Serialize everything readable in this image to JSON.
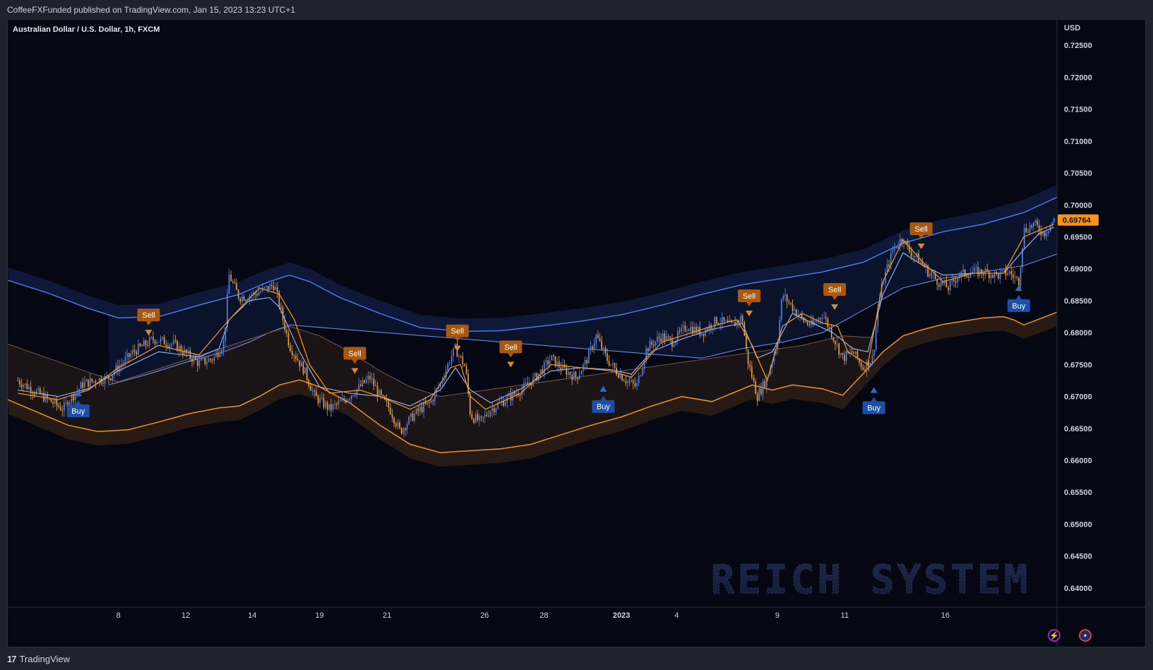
{
  "header": {
    "publisher": "CoffeeFXFunded published on TradingView.com, Jan 15, 2023 13:23 UTC+1"
  },
  "footer": {
    "brand": "TradingView"
  },
  "icons": {
    "logo": "tradingview-logo-icon",
    "lightning": "lightning-icon",
    "flag": "australia-flag-icon"
  },
  "colors": {
    "background": "#050813",
    "up_candle": "#5b86e5",
    "down_candle": "#f2a33a",
    "blue_line": "#4f7df5",
    "orange_line": "#f0921e",
    "buy_label": "#1d4fa8",
    "sell_label": "#a8590f",
    "price_tag": "#f7931a",
    "watermark": "#1b2542"
  },
  "chart_data": {
    "type": "candlestick",
    "title": "Australian Dollar / U.S. Dollar, 1h, FXCM",
    "currency": "USD",
    "watermark": "REICH SYSTEM",
    "last_price": 0.69764,
    "last_price_label": "0.69764",
    "ylim": [
      0.637,
      0.729
    ],
    "yticks": [
      {
        "value": 0.725,
        "label": "0.72500"
      },
      {
        "value": 0.72,
        "label": "0.72000"
      },
      {
        "value": 0.715,
        "label": "0.71500"
      },
      {
        "value": 0.71,
        "label": "0.71000"
      },
      {
        "value": 0.705,
        "label": "0.70500"
      },
      {
        "value": 0.7,
        "label": "0.70000"
      },
      {
        "value": 0.695,
        "label": "0.69500"
      },
      {
        "value": 0.69,
        "label": "0.69000"
      },
      {
        "value": 0.685,
        "label": "0.68500"
      },
      {
        "value": 0.68,
        "label": "0.68000"
      },
      {
        "value": 0.675,
        "label": "0.67500"
      },
      {
        "value": 0.67,
        "label": "0.67000"
      },
      {
        "value": 0.665,
        "label": "0.66500"
      },
      {
        "value": 0.66,
        "label": "0.66000"
      },
      {
        "value": 0.655,
        "label": "0.65500"
      },
      {
        "value": 0.65,
        "label": "0.65000"
      },
      {
        "value": 0.645,
        "label": "0.64500"
      },
      {
        "value": 0.64,
        "label": "0.64000"
      }
    ],
    "xlim": [
      5.9,
      16.33
    ],
    "xticks": [
      {
        "t": 7.0,
        "label": "8"
      },
      {
        "t": 7.67,
        "label": "12"
      },
      {
        "t": 8.33,
        "label": "14"
      },
      {
        "t": 9.0,
        "label": "19"
      },
      {
        "t": 9.67,
        "label": "21"
      },
      {
        "t": 10.64,
        "label": "26"
      },
      {
        "t": 11.23,
        "label": "28"
      },
      {
        "t": 12.0,
        "label": "2023",
        "bold": true
      },
      {
        "t": 12.55,
        "label": "4"
      },
      {
        "t": 13.55,
        "label": "9"
      },
      {
        "t": 14.22,
        "label": "11"
      },
      {
        "t": 15.22,
        "label": "16"
      }
    ],
    "price_path": [
      [
        6.0,
        0.6725
      ],
      [
        6.2,
        0.6705
      ],
      [
        6.45,
        0.668
      ],
      [
        6.5,
        0.6692
      ],
      [
        6.65,
        0.672
      ],
      [
        6.9,
        0.673
      ],
      [
        7.15,
        0.677
      ],
      [
        7.35,
        0.679
      ],
      [
        7.55,
        0.6782
      ],
      [
        7.65,
        0.677
      ],
      [
        7.8,
        0.6752
      ],
      [
        7.95,
        0.676
      ],
      [
        8.05,
        0.6785
      ],
      [
        8.1,
        0.689
      ],
      [
        8.2,
        0.6855
      ],
      [
        8.35,
        0.686
      ],
      [
        8.55,
        0.6875
      ],
      [
        8.7,
        0.678
      ],
      [
        8.85,
        0.674
      ],
      [
        8.95,
        0.67
      ],
      [
        9.1,
        0.668
      ],
      [
        9.25,
        0.6695
      ],
      [
        9.4,
        0.6715
      ],
      [
        9.5,
        0.673
      ],
      [
        9.6,
        0.67
      ],
      [
        9.7,
        0.668
      ],
      [
        9.8,
        0.6645
      ],
      [
        9.9,
        0.6665
      ],
      [
        10.0,
        0.668
      ],
      [
        10.1,
        0.669
      ],
      [
        10.2,
        0.672
      ],
      [
        10.3,
        0.676
      ],
      [
        10.35,
        0.6775
      ],
      [
        10.45,
        0.6745
      ],
      [
        10.5,
        0.667
      ],
      [
        10.6,
        0.666
      ],
      [
        10.7,
        0.668
      ],
      [
        10.85,
        0.6695
      ],
      [
        11.0,
        0.671
      ],
      [
        11.15,
        0.673
      ],
      [
        11.3,
        0.676
      ],
      [
        11.4,
        0.6745
      ],
      [
        11.55,
        0.673
      ],
      [
        11.65,
        0.6755
      ],
      [
        11.75,
        0.6795
      ],
      [
        11.85,
        0.676
      ],
      [
        11.95,
        0.674
      ],
      [
        12.05,
        0.6725
      ],
      [
        12.15,
        0.6715
      ],
      [
        12.25,
        0.6775
      ],
      [
        12.4,
        0.6795
      ],
      [
        12.5,
        0.6785
      ],
      [
        12.65,
        0.681
      ],
      [
        12.8,
        0.68
      ],
      [
        12.95,
        0.682
      ],
      [
        13.1,
        0.681
      ],
      [
        13.2,
        0.6825
      ],
      [
        13.25,
        0.676
      ],
      [
        13.35,
        0.67
      ],
      [
        13.45,
        0.673
      ],
      [
        13.55,
        0.6785
      ],
      [
        13.6,
        0.686
      ],
      [
        13.7,
        0.684
      ],
      [
        13.8,
        0.682
      ],
      [
        13.9,
        0.681
      ],
      [
        14.0,
        0.683
      ],
      [
        14.1,
        0.6795
      ],
      [
        14.2,
        0.676
      ],
      [
        14.3,
        0.677
      ],
      [
        14.4,
        0.6745
      ],
      [
        14.5,
        0.676
      ],
      [
        14.55,
        0.684
      ],
      [
        14.6,
        0.688
      ],
      [
        14.7,
        0.693
      ],
      [
        14.8,
        0.695
      ],
      [
        14.85,
        0.693
      ],
      [
        14.95,
        0.6915
      ],
      [
        15.05,
        0.6895
      ],
      [
        15.15,
        0.688
      ],
      [
        15.25,
        0.687
      ],
      [
        15.35,
        0.689
      ],
      [
        15.5,
        0.6895
      ],
      [
        15.6,
        0.6895
      ],
      [
        15.75,
        0.689
      ],
      [
        15.85,
        0.6895
      ],
      [
        15.95,
        0.688
      ],
      [
        16.0,
        0.696
      ],
      [
        16.1,
        0.697
      ],
      [
        16.2,
        0.6955
      ],
      [
        16.3,
        0.6976
      ]
    ],
    "blue_fast_path": [
      [
        6.0,
        0.671
      ],
      [
        6.4,
        0.67
      ],
      [
        6.7,
        0.6712
      ],
      [
        7.0,
        0.674
      ],
      [
        7.4,
        0.677
      ],
      [
        7.8,
        0.6762
      ],
      [
        8.0,
        0.6775
      ],
      [
        8.1,
        0.682
      ],
      [
        8.3,
        0.685
      ],
      [
        8.5,
        0.6855
      ],
      [
        8.6,
        0.684
      ],
      [
        8.8,
        0.677
      ],
      [
        9.0,
        0.6715
      ],
      [
        9.3,
        0.6705
      ],
      [
        9.6,
        0.67
      ],
      [
        9.9,
        0.6685
      ],
      [
        10.2,
        0.671
      ],
      [
        10.35,
        0.6745
      ],
      [
        10.5,
        0.671
      ],
      [
        10.7,
        0.669
      ],
      [
        11.0,
        0.6712
      ],
      [
        11.3,
        0.674
      ],
      [
        11.6,
        0.6745
      ],
      [
        11.9,
        0.6742
      ],
      [
        12.1,
        0.6735
      ],
      [
        12.3,
        0.677
      ],
      [
        12.6,
        0.679
      ],
      [
        12.9,
        0.6805
      ],
      [
        13.2,
        0.6815
      ],
      [
        13.35,
        0.676
      ],
      [
        13.5,
        0.677
      ],
      [
        13.7,
        0.683
      ],
      [
        13.9,
        0.6815
      ],
      [
        14.1,
        0.68
      ],
      [
        14.3,
        0.6775
      ],
      [
        14.45,
        0.677
      ],
      [
        14.6,
        0.686
      ],
      [
        14.8,
        0.6925
      ],
      [
        15.0,
        0.6905
      ],
      [
        15.2,
        0.689
      ],
      [
        15.5,
        0.6893
      ],
      [
        15.8,
        0.6893
      ],
      [
        16.0,
        0.693
      ],
      [
        16.15,
        0.6955
      ],
      [
        16.3,
        0.6965
      ]
    ],
    "orange_fast_path": [
      [
        6.0,
        0.6705
      ],
      [
        6.4,
        0.6695
      ],
      [
        6.7,
        0.671
      ],
      [
        7.0,
        0.6745
      ],
      [
        7.4,
        0.678
      ],
      [
        7.8,
        0.6765
      ],
      [
        8.1,
        0.682
      ],
      [
        8.4,
        0.687
      ],
      [
        8.6,
        0.686
      ],
      [
        8.75,
        0.682
      ],
      [
        8.9,
        0.675
      ],
      [
        9.1,
        0.6705
      ],
      [
        9.4,
        0.671
      ],
      [
        9.6,
        0.67
      ],
      [
        9.9,
        0.668
      ],
      [
        10.1,
        0.6695
      ],
      [
        10.3,
        0.6745
      ],
      [
        10.4,
        0.675
      ],
      [
        10.5,
        0.67
      ],
      [
        10.65,
        0.668
      ],
      [
        11.0,
        0.6705
      ],
      [
        11.3,
        0.675
      ],
      [
        11.6,
        0.6745
      ],
      [
        11.9,
        0.674
      ],
      [
        12.1,
        0.673
      ],
      [
        12.4,
        0.6785
      ],
      [
        12.7,
        0.68
      ],
      [
        12.9,
        0.681
      ],
      [
        13.15,
        0.682
      ],
      [
        13.3,
        0.678
      ],
      [
        13.45,
        0.6725
      ],
      [
        13.6,
        0.681
      ],
      [
        13.8,
        0.683
      ],
      [
        14.0,
        0.6815
      ],
      [
        14.15,
        0.681
      ],
      [
        14.25,
        0.677
      ],
      [
        14.45,
        0.675
      ],
      [
        14.6,
        0.688
      ],
      [
        14.8,
        0.6945
      ],
      [
        15.0,
        0.691
      ],
      [
        15.2,
        0.688
      ],
      [
        15.5,
        0.6893
      ],
      [
        15.8,
        0.6893
      ],
      [
        16.0,
        0.695
      ],
      [
        16.15,
        0.696
      ],
      [
        16.3,
        0.697
      ]
    ],
    "blue_upper_band": [
      [
        5.9,
        0.6882
      ],
      [
        6.3,
        0.6862
      ],
      [
        6.7,
        0.6838
      ],
      [
        7.0,
        0.6823
      ],
      [
        7.4,
        0.6825
      ],
      [
        7.8,
        0.6843
      ],
      [
        8.2,
        0.686
      ],
      [
        8.5,
        0.688
      ],
      [
        8.7,
        0.689
      ],
      [
        8.9,
        0.688
      ],
      [
        9.2,
        0.6855
      ],
      [
        9.6,
        0.683
      ],
      [
        10.0,
        0.6808
      ],
      [
        10.4,
        0.6802
      ],
      [
        10.8,
        0.6803
      ],
      [
        11.2,
        0.681
      ],
      [
        11.6,
        0.6818
      ],
      [
        12.0,
        0.6828
      ],
      [
        12.4,
        0.6843
      ],
      [
        12.8,
        0.686
      ],
      [
        13.2,
        0.6875
      ],
      [
        13.6,
        0.6885
      ],
      [
        14.0,
        0.6895
      ],
      [
        14.4,
        0.691
      ],
      [
        14.8,
        0.694
      ],
      [
        15.2,
        0.6958
      ],
      [
        15.6,
        0.697
      ],
      [
        16.0,
        0.6988
      ],
      [
        16.33,
        0.7012
      ]
    ],
    "blue_lower_band": [
      [
        6.9,
        0.6718
      ],
      [
        7.3,
        0.6735
      ],
      [
        7.7,
        0.6755
      ],
      [
        8.05,
        0.677
      ],
      [
        8.3,
        0.6785
      ],
      [
        8.5,
        0.68
      ],
      [
        8.7,
        0.6812
      ],
      [
        12.8,
        0.676
      ],
      [
        13.2,
        0.6775
      ],
      [
        13.6,
        0.6785
      ],
      [
        14.0,
        0.68
      ],
      [
        14.4,
        0.6835
      ],
      [
        14.8,
        0.687
      ],
      [
        15.2,
        0.6885
      ],
      [
        15.6,
        0.6895
      ],
      [
        16.0,
        0.6905
      ],
      [
        16.33,
        0.6923
      ]
    ],
    "orange_upper_band": [
      [
        5.9,
        0.6782
      ],
      [
        6.3,
        0.676
      ],
      [
        6.7,
        0.6738
      ],
      [
        7.0,
        0.6723
      ],
      [
        8.7,
        0.681
      ],
      [
        9.0,
        0.6795
      ],
      [
        9.3,
        0.677
      ],
      [
        9.6,
        0.674
      ],
      [
        9.9,
        0.6715
      ],
      [
        10.2,
        0.67
      ],
      [
        13.8,
        0.678
      ],
      [
        14.2,
        0.6795
      ],
      [
        14.5,
        0.6792
      ]
    ],
    "orange_lower_band": [
      [
        5.9,
        0.6695
      ],
      [
        6.2,
        0.6675
      ],
      [
        6.5,
        0.6655
      ],
      [
        6.8,
        0.6645
      ],
      [
        7.1,
        0.6648
      ],
      [
        7.4,
        0.666
      ],
      [
        7.7,
        0.6673
      ],
      [
        8.0,
        0.6682
      ],
      [
        8.2,
        0.6685
      ],
      [
        8.4,
        0.67
      ],
      [
        8.6,
        0.6718
      ],
      [
        8.8,
        0.6726
      ],
      [
        9.0,
        0.6715
      ],
      [
        9.3,
        0.669
      ],
      [
        9.6,
        0.6655
      ],
      [
        9.9,
        0.6625
      ],
      [
        10.2,
        0.6612
      ],
      [
        10.5,
        0.6615
      ],
      [
        10.8,
        0.6618
      ],
      [
        11.1,
        0.6625
      ],
      [
        11.4,
        0.664
      ],
      [
        11.7,
        0.6655
      ],
      [
        12.0,
        0.6668
      ],
      [
        12.3,
        0.6685
      ],
      [
        12.6,
        0.67
      ],
      [
        12.9,
        0.6692
      ],
      [
        13.1,
        0.6705
      ],
      [
        13.3,
        0.6718
      ],
      [
        13.5,
        0.671
      ],
      [
        13.7,
        0.6718
      ],
      [
        14.0,
        0.6712
      ],
      [
        14.2,
        0.6702
      ],
      [
        14.4,
        0.6735
      ],
      [
        14.6,
        0.677
      ],
      [
        14.8,
        0.6795
      ],
      [
        15.0,
        0.6805
      ],
      [
        15.2,
        0.6813
      ],
      [
        15.4,
        0.6818
      ],
      [
        15.6,
        0.6823
      ],
      [
        15.8,
        0.6825
      ],
      [
        15.9,
        0.682
      ],
      [
        16.0,
        0.6812
      ],
      [
        16.33,
        0.6832
      ]
    ],
    "signals": [
      {
        "type": "Buy",
        "t": 6.6,
        "price": 0.6705
      },
      {
        "type": "Sell",
        "t": 7.3,
        "price": 0.68
      },
      {
        "type": "Sell",
        "t": 9.35,
        "price": 0.674
      },
      {
        "type": "Sell",
        "t": 10.37,
        "price": 0.6775
      },
      {
        "type": "Sell",
        "t": 10.9,
        "price": 0.675
      },
      {
        "type": "Buy",
        "t": 11.82,
        "price": 0.6712
      },
      {
        "type": "Sell",
        "t": 13.27,
        "price": 0.683
      },
      {
        "type": "Sell",
        "t": 14.12,
        "price": 0.684
      },
      {
        "type": "Buy",
        "t": 14.51,
        "price": 0.671
      },
      {
        "type": "Sell",
        "t": 14.98,
        "price": 0.6935
      },
      {
        "type": "Buy",
        "t": 15.95,
        "price": 0.687
      }
    ]
  }
}
